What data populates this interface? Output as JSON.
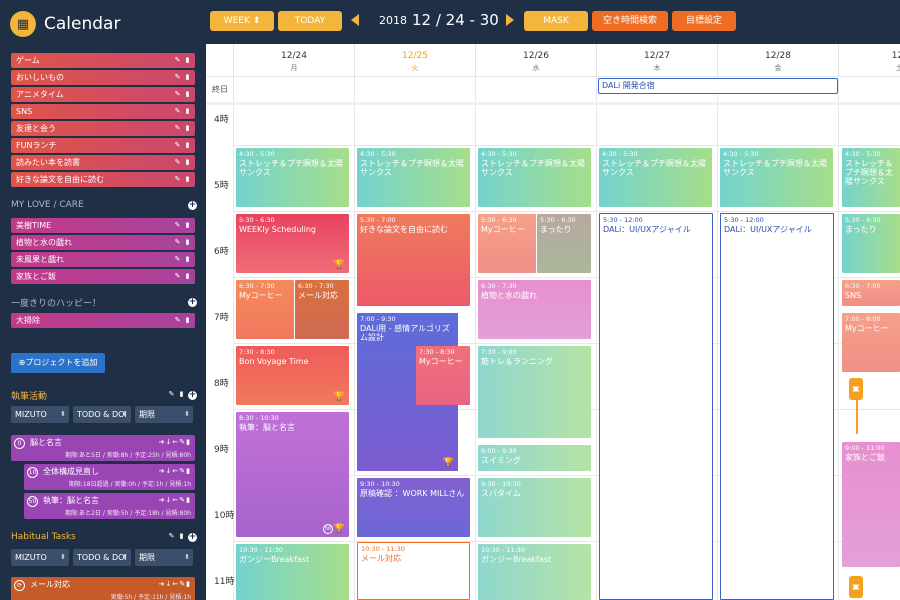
{
  "app": {
    "title": "Calendar",
    "logo_icon": "calendar-icon"
  },
  "sidebar": {
    "fun_items": [
      "ゲーム",
      "おいしいもの",
      "アニメタイム",
      "SNS",
      "友達と会う",
      "FUNランチ",
      "読みたい本を読書",
      "好きな論文を自由に読む"
    ],
    "love_title": "MY LOVE / CARE",
    "love_items": [
      "美樹TIME",
      "植物と水の戯れ",
      "未風果と戯れ",
      "家族とご飯"
    ],
    "happy_title": "一度きりのハッピー！",
    "happy_items": [
      "大掃除"
    ],
    "add_project": "⊕プロジェクトを追加",
    "writing": {
      "title": "執筆活動",
      "filters": [
        "MIZUTO",
        "TODO & DOI",
        "期限"
      ],
      "tasks": [
        {
          "num": "0",
          "name": "脳と名言",
          "meta": "期限:あと5日 / 実働:8h / 予定:25h / 見積:80h"
        },
        {
          "num": "10",
          "name": "全体構成見直し",
          "meta": "期限:18日超過 / 実働:0h / 予定:1h / 見積:1h"
        },
        {
          "num": "50",
          "name": "執筆：脳と名言",
          "meta": "期限:あと2日 / 実働:5h / 予定:18h / 見積:80h"
        }
      ]
    },
    "habitual": {
      "title": "Habitual Tasks",
      "filters": [
        "MIZUTO",
        "TODO & DOI",
        "期限"
      ],
      "tasks": [
        {
          "name": "メール対応",
          "meta": "実働:5h / 予定:11h / 見積:1h"
        }
      ]
    }
  },
  "toolbar": {
    "week": "WEEK",
    "today": "TODAY",
    "year": "2018",
    "range": "12 / 24 - 30",
    "mask": "MASK",
    "free_search": "空き時間検索",
    "goal": "目標設定"
  },
  "calendar": {
    "allday_label": "終日",
    "days": [
      {
        "date": "12/24",
        "wd": "月"
      },
      {
        "date": "12/25",
        "wd": "火"
      },
      {
        "date": "12/26",
        "wd": "水"
      },
      {
        "date": "12/27",
        "wd": "木"
      },
      {
        "date": "12/28",
        "wd": "金"
      },
      {
        "date": "12/",
        "wd": "土"
      }
    ],
    "hours": [
      "4時",
      "5時",
      "6時",
      "7時",
      "8時",
      "9時",
      "10時",
      "11時"
    ],
    "allday_event": "DALi 開発合宿",
    "events": {
      "e1": {
        "t": "4:30 - 5:30",
        "n": "ストレッチ＆プチ瞑想＆太陽サンクス"
      },
      "e2": {
        "t": "5:30 - 6:30",
        "n": "WEEKly Scheduling"
      },
      "e3": {
        "t": "6:30 - 7:30",
        "n": "Myコーヒー"
      },
      "e4": {
        "t": "6:30 - 7:30",
        "n": "メール対応"
      },
      "e5": {
        "t": "7:30 - 8:30",
        "n": "Bon Voyage Time"
      },
      "e6": {
        "t": "8:30 - 10:30",
        "n": "執筆：脳と名言"
      },
      "e7": {
        "t": "10:30 - 11:30",
        "n": "ガンジーBreakfast"
      },
      "e8": {
        "t": "4:30 - 5:30",
        "n": "ストレッチ＆プチ瞑想＆太陽サンクス"
      },
      "e9": {
        "t": "5:30 - 7:00",
        "n": "好きな論文を自由に読む"
      },
      "e10": {
        "t": "7:00 - 9:30",
        "n": "DALi用 - 感情アルゴリズム設計"
      },
      "e11": {
        "t": "7:30 - 8:30",
        "n": "Myコーヒー"
      },
      "e12": {
        "t": "9:30 - 10:30",
        "n": "原稿確認 ：WORK MILLさん"
      },
      "e13": {
        "t": "10:30 - 11:30",
        "n": "メール対応"
      },
      "e14": {
        "t": "4:30 - 5:30",
        "n": "ストレッチ＆プチ瞑想＆太陽サンクス"
      },
      "e15": {
        "t": "5:30 - 6:30",
        "n": "Myコーヒー"
      },
      "e16": {
        "t": "5:30 - 6:30",
        "n": "まったり"
      },
      "e17": {
        "t": "6:30 - 7:30",
        "n": "植物と水の戯れ"
      },
      "e18": {
        "t": "7:30 - 9:00",
        "n": "筋トレ＆ランニング"
      },
      "e19": {
        "t": "9:00 - 9:30",
        "n": "スイミング"
      },
      "e20": {
        "t": "9:30 - 10:30",
        "n": "スパタイム"
      },
      "e21": {
        "t": "10:30 - 11:30",
        "n": "ガンジーBreakfast"
      },
      "e22": {
        "t": "4:30 - 5:30",
        "n": "ストレッチ＆プチ瞑想＆太陽サンクス"
      },
      "e23": {
        "t": "5:30 - 12:00",
        "n": "DALi：UI/UXアジャイル"
      },
      "e24": {
        "t": "4:30 - 5:30",
        "n": "ストレッチ＆プチ瞑想＆太陽サンクス"
      },
      "e25": {
        "t": "5:30 - 12:00",
        "n": "DALi：UI/UXアジャイル"
      },
      "e26": {
        "t": "4:30 - 5:30",
        "n": "ストレッチ＆プチ瞑想＆太陽サンクス"
      },
      "e27": {
        "t": "5:30 - 6:30",
        "n": "まったり"
      },
      "e28": {
        "t": "6:30 - 7:00",
        "n": "SNS"
      },
      "e29": {
        "t": "7:00 - 8:00",
        "n": "Myコーヒー"
      },
      "e30": {
        "t": "9:00 - 11:00",
        "n": "家族とご飯"
      }
    },
    "badges": {
      "b6": "50"
    }
  }
}
